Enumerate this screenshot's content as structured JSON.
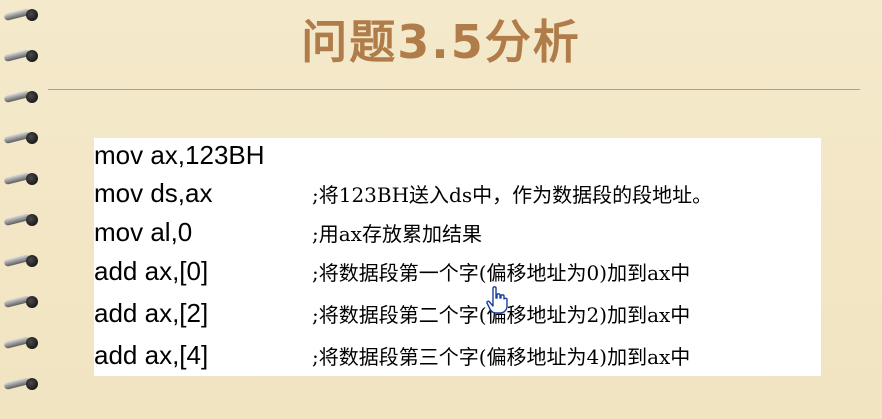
{
  "slide": {
    "title": "问题3.5分析"
  },
  "code_lines": [
    {
      "code": "mov ax,123BH",
      "comment": ""
    },
    {
      "code": "mov ds,ax",
      "comment": ";将123BH送入ds中，作为数据段的段地址。"
    },
    {
      "code": "mov al,0",
      "comment": ";用ax存放累加结果"
    },
    {
      "code": "add ax,[0]",
      "comment": ";将数据段第一个字(偏移地址为0)加到ax中"
    },
    {
      "code": "add ax,[2]",
      "comment": ";将数据段第二个字(偏移地址为2)加到ax中"
    },
    {
      "code": "add ax,[4]",
      "comment": ";将数据段第三个字(偏移地址为4)加到ax中"
    }
  ],
  "icons": {
    "binding": "spiral-binding",
    "cursor": "hand-pointer-icon"
  },
  "colors": {
    "background": "#f2e6c5",
    "title": "#b07c4a",
    "divider": "#b89e80",
    "code_box": "#ffffff"
  }
}
